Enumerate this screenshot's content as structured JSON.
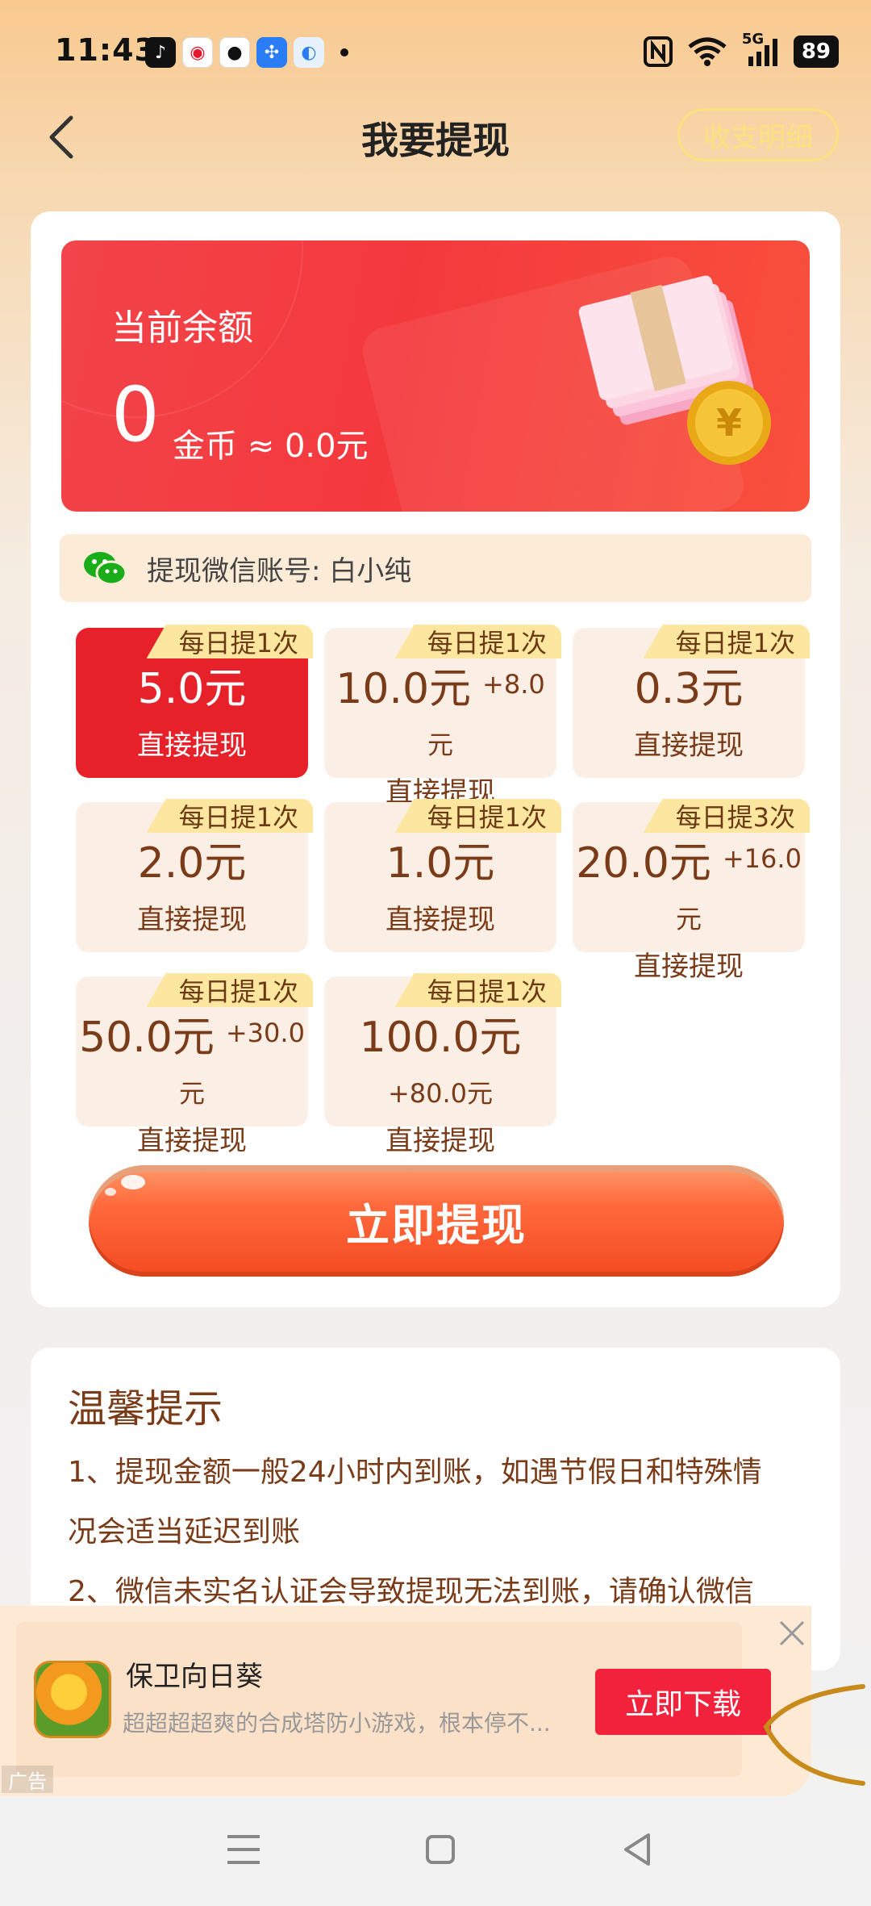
{
  "status_bar": {
    "time": "11:43",
    "app_icons": [
      "douyin-icon",
      "weibo-icon",
      "qq-icon",
      "pinwheel-icon",
      "browser-icon"
    ],
    "network": "5G",
    "battery": "89"
  },
  "header": {
    "title": "我要提现",
    "detail_button": "收支明细"
  },
  "balance": {
    "label": "当前余额",
    "coins": "0",
    "unit_text": "金币 ≈ 0.0元"
  },
  "wechat": {
    "account_text": "提现微信账号: 白小纯"
  },
  "options": [
    {
      "tag": "每日提1次",
      "amount": "5.0元",
      "sub": "直接提现",
      "selected": true
    },
    {
      "tag": "每日提1次",
      "amount": "10.0元",
      "extra": "+8.0",
      "unit2": "元",
      "sub": "直接提现"
    },
    {
      "tag": "每日提1次",
      "amount": "0.3元",
      "sub": "直接提现"
    },
    {
      "tag": "每日提1次",
      "amount": "2.0元",
      "sub": "直接提现"
    },
    {
      "tag": "每日提1次",
      "amount": "1.0元",
      "sub": "直接提现"
    },
    {
      "tag": "每日提3次",
      "amount": "20.0元",
      "extra": "+16.0",
      "unit2": "元",
      "sub": "直接提现"
    },
    {
      "tag": "每日提1次",
      "amount": "50.0元",
      "extra": "+30.0",
      "unit2": "元",
      "sub": "直接提现"
    },
    {
      "tag": "每日提1次",
      "amount": "100.0元",
      "unit2": "+80.0元",
      "sub": "直接提现"
    }
  ],
  "cta": "立即提现",
  "tips": {
    "title": "温馨提示",
    "line1": "1、提现金额一般24小时内到账，如遇节假日和特殊情",
    "line2": "况会适当延迟到账",
    "line3": "2、微信未实名认证会导致提现无法到账，请确认微信"
  },
  "ad": {
    "title": "保卫向日葵",
    "description": "超超超超爽的合成塔防小游戏，根本停不...",
    "button": "立即下载",
    "label": "广告"
  },
  "colors": {
    "accent_red": "#e62129",
    "brown_text": "#7a3b18",
    "cta_orange": "#f44a22"
  }
}
